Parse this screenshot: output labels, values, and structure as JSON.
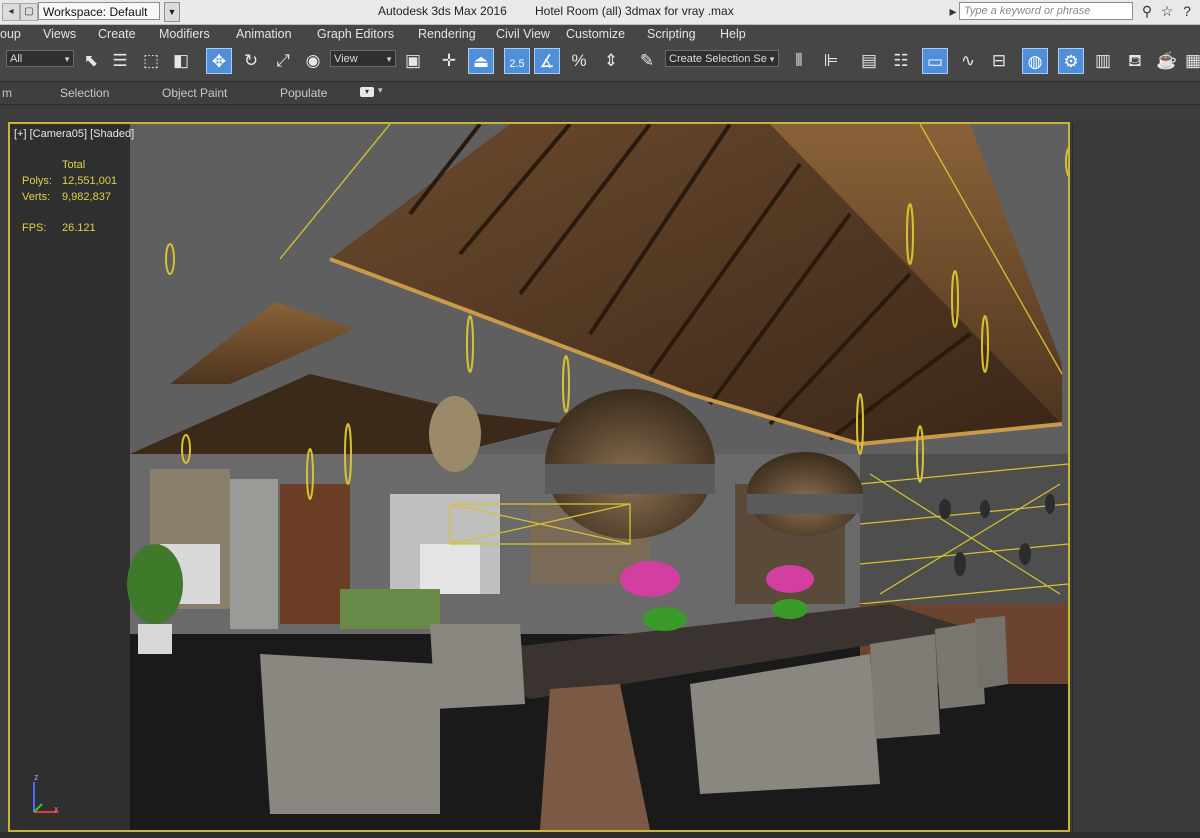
{
  "title_bar": {
    "workspace": "Workspace: Default",
    "app_title": "Autodesk 3ds Max 2016",
    "file_title": "Hotel Room  (all) 3dmax for vray .max",
    "search_placeholder": "Type a keyword or phrase"
  },
  "menu": [
    "oup",
    "Views",
    "Create",
    "Modifiers",
    "Animation",
    "Graph Editors",
    "Rendering",
    "Civil View",
    "Customize",
    "Scripting",
    "Help"
  ],
  "toolbar": {
    "filter_value": "All",
    "coord_value": "View",
    "snap_label": "2.5",
    "named_selection": "Create Selection Se"
  },
  "ribbon": [
    "m",
    "Selection",
    "Object Paint",
    "Populate"
  ],
  "viewport": {
    "label": "[+] [Camera05] [Shaded]",
    "stats": {
      "total_label": "Total",
      "polys_label": "Polys:",
      "polys_value": "12,551,001",
      "verts_label": "Verts:",
      "verts_value": "9,982,837",
      "fps_label": "FPS:",
      "fps_value": "26.121"
    },
    "axis_x": "x",
    "axis_z": "z"
  },
  "colors": {
    "accent": "#4f8fd9",
    "viewport_border": "#c8b43a",
    "stats_text": "#e1d14a",
    "ui_background": "#464646"
  }
}
